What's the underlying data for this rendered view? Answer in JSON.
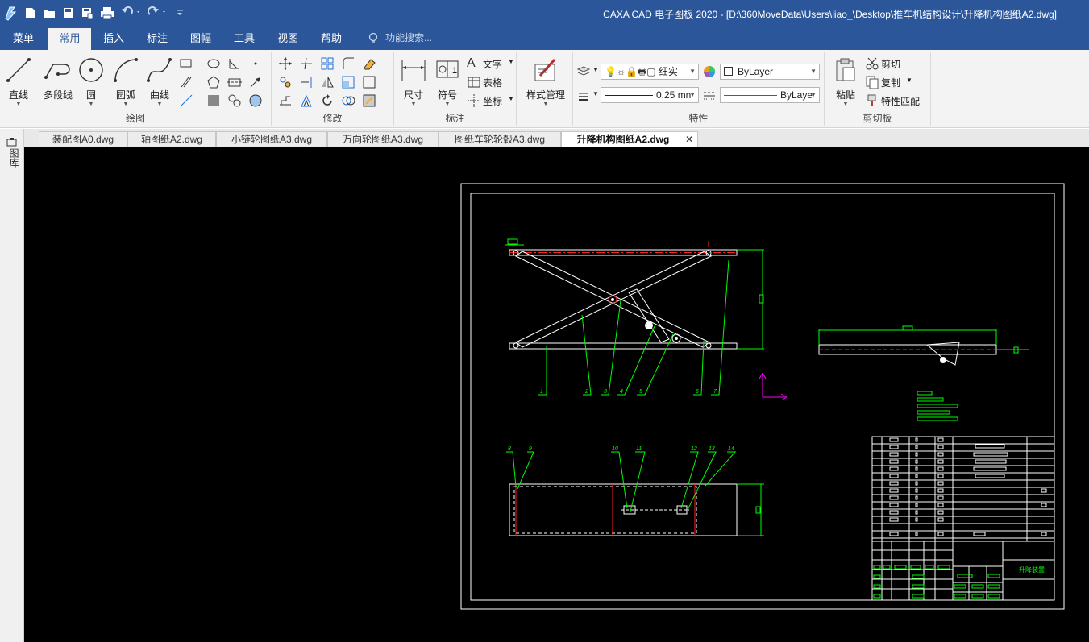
{
  "window": {
    "title": "CAXA CAD 电子图板 2020 - [D:\\360MoveData\\Users\\liao_\\Desktop\\推车机结构设计\\升降机构图纸A2.dwg]"
  },
  "menu": {
    "items": [
      "菜单",
      "常用",
      "插入",
      "标注",
      "图幅",
      "工具",
      "视图",
      "帮助"
    ],
    "active_index": 1,
    "search_placeholder": "功能搜索..."
  },
  "ribbon": {
    "draw": {
      "label": "绘图",
      "line": "直线",
      "polyline": "多段线",
      "circle": "圆",
      "arc": "圆弧",
      "curve": "曲线"
    },
    "modify": {
      "label": "修改"
    },
    "annotate": {
      "label": "标注",
      "dimension": "尺寸",
      "symbol": "符号",
      "text": "文字",
      "table": "表格",
      "coord": "坐标"
    },
    "style": {
      "label": "样式管理"
    },
    "properties": {
      "label": "特性",
      "layer_value": "细实",
      "color_value": "ByLayer",
      "lineweight_value": "0.25 mn",
      "linetype_value": "ByLaye"
    },
    "clipboard": {
      "label": "剪切板",
      "paste": "粘贴",
      "cut": "剪切",
      "copy": "复制",
      "match": "特性匹配"
    }
  },
  "tabs": [
    {
      "label": "装配图A0.dwg",
      "active": false
    },
    {
      "label": "轴图纸A2.dwg",
      "active": false
    },
    {
      "label": "小链轮图纸A3.dwg",
      "active": false
    },
    {
      "label": "万向轮图纸A3.dwg",
      "active": false
    },
    {
      "label": "图纸车轮轮毂A3.dwg",
      "active": false
    },
    {
      "label": "升降机构图纸A2.dwg",
      "active": true
    }
  ],
  "leftbar": {
    "label": "图库"
  },
  "drawing": {
    "title_block_name": "升降装置",
    "balloons": [
      "1",
      "2",
      "3",
      "4",
      "5",
      "6",
      "7",
      "8",
      "9",
      "10",
      "11",
      "12",
      "13",
      "14"
    ]
  },
  "colors": {
    "titlebar": "#2b579a",
    "ribbon_bg": "#f3f3f3",
    "canvas_bg": "#000000",
    "line_white": "#ffffff",
    "line_green": "#00ff00",
    "line_red": "#ff2020",
    "ucs_magenta": "#ff00ff"
  }
}
